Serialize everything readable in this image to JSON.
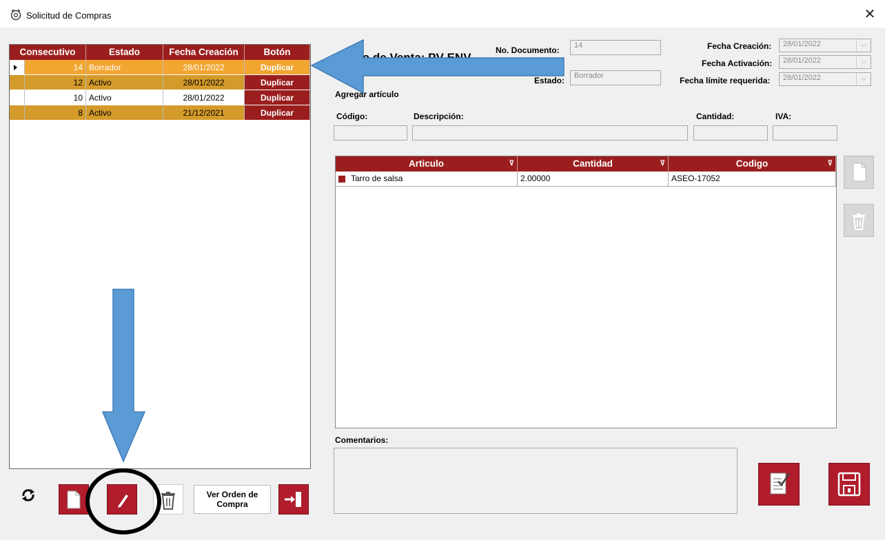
{
  "window": {
    "title": "Solicitud de Compras",
    "close_glyph": "✕"
  },
  "left_grid": {
    "headers": [
      "Consecutivo",
      "Estado",
      "Fecha Creación",
      "Botón"
    ],
    "rows": [
      {
        "consecutivo": "14",
        "estado": "Borrador",
        "fecha": "28/01/2022",
        "boton": "Duplicar"
      },
      {
        "consecutivo": "12",
        "estado": "Activo",
        "fecha": "28/01/2022",
        "boton": "Duplicar"
      },
      {
        "consecutivo": "10",
        "estado": "Activo",
        "fecha": "28/01/2022",
        "boton": "Duplicar"
      },
      {
        "consecutivo": "8",
        "estado": "Activo",
        "fecha": "21/12/2021",
        "boton": "Duplicar"
      }
    ]
  },
  "form": {
    "punto_venta": "Punto de Venta: PV-ENV",
    "no_documento_label": "No. Documento:",
    "no_documento_value": "14",
    "estado_label": "Estado:",
    "estado_value": "Borrador",
    "fecha_creacion_label": "Fecha Creación:",
    "fecha_creacion_value": "28/01/2022",
    "fecha_activacion_label": "Fecha Activación:",
    "fecha_activacion_value": "28/01/2022",
    "fecha_limite_label": "Fecha límite requerida:",
    "fecha_limite_value": "28/01/2022",
    "agregar_articulo": "Agregar artículo",
    "codigo_label": "Código:",
    "descripcion_label": "Descripción:",
    "cantidad_label": "Cantidad:",
    "iva_label": "IVA:",
    "comentarios_label": "Comentarios:"
  },
  "items_grid": {
    "headers": [
      "Articulo",
      "Cantidad",
      "Codigo"
    ],
    "filter_glyph": "⊽",
    "rows": [
      {
        "articulo": "Tarro de salsa",
        "cantidad": "2.00000",
        "codigo": "ASEO-17052"
      }
    ]
  },
  "buttons": {
    "ver_orden_line1": "Ver Orden de",
    "ver_orden_line2": "Compra"
  },
  "colors": {
    "header_red": "#9b1e1e",
    "row_gold": "#d49a2a",
    "selected_row": "#f2a531",
    "arrow_blue": "#5b9bd5",
    "button_red": "#b01c2c"
  }
}
